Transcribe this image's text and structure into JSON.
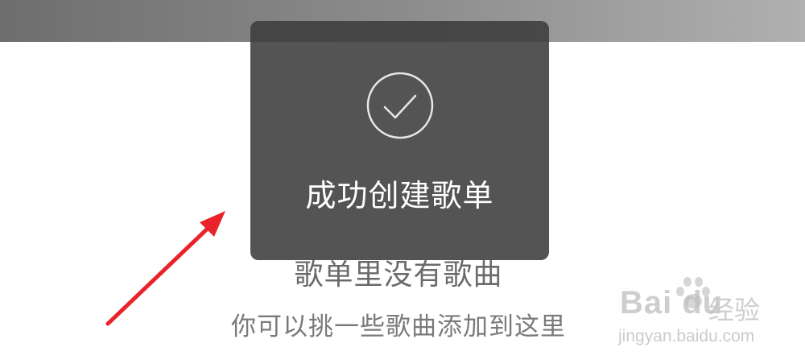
{
  "toast": {
    "icon": "checkmark-circle-icon",
    "message": "成功创建歌单"
  },
  "empty_state": {
    "title": "歌单里没有歌曲",
    "subtitle": "你可以挑一些歌曲添加到这里"
  },
  "annotation": {
    "arrow_color": "#e8242a"
  },
  "watermark": {
    "brand": "Bai du",
    "brand_cn": "经验",
    "url": "jingyan.baidu.com"
  }
}
